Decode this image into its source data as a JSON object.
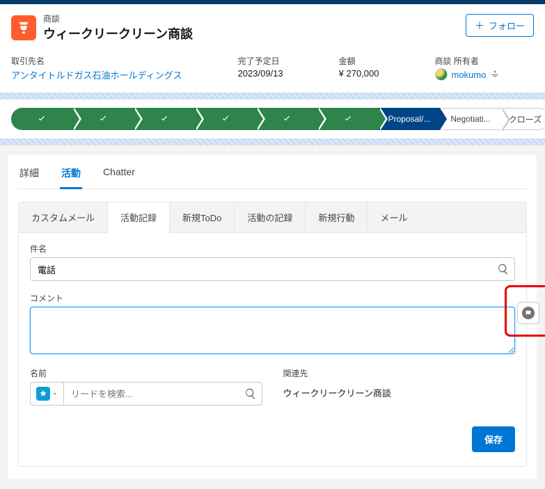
{
  "header": {
    "type_label": "商談",
    "title": "ウィークリークリーン商談",
    "follow_label": "フォロー"
  },
  "fields": {
    "account": {
      "label": "取引先名",
      "value": "アンタイトルドガス石油ホールディングス"
    },
    "close_date": {
      "label": "完了予定日",
      "value": "2023/09/13"
    },
    "amount": {
      "label": "金額",
      "value": "¥ 270,000"
    },
    "owner": {
      "label": "商談 所有者",
      "value": "mokumo"
    }
  },
  "path": {
    "current": "Proposal/...",
    "future1": "Negotiati...",
    "future2": "クローズ"
  },
  "main_tabs": {
    "details": "詳細",
    "activity": "活動",
    "chatter": "Chatter"
  },
  "sub_tabs": {
    "custom_mail": "カスタムメール",
    "activity_rec": "活動記録",
    "new_todo": "新規ToDo",
    "log_activity": "活動の記録",
    "new_action": "新規行動",
    "mail": "メール"
  },
  "form": {
    "subject_label": "件名",
    "subject_value": "電話",
    "comment_label": "コメント",
    "name_label": "名前",
    "name_placeholder": "リードを検索...",
    "related_label": "関連先",
    "related_value": "ウィークリークリーン商談",
    "save_label": "保存"
  }
}
